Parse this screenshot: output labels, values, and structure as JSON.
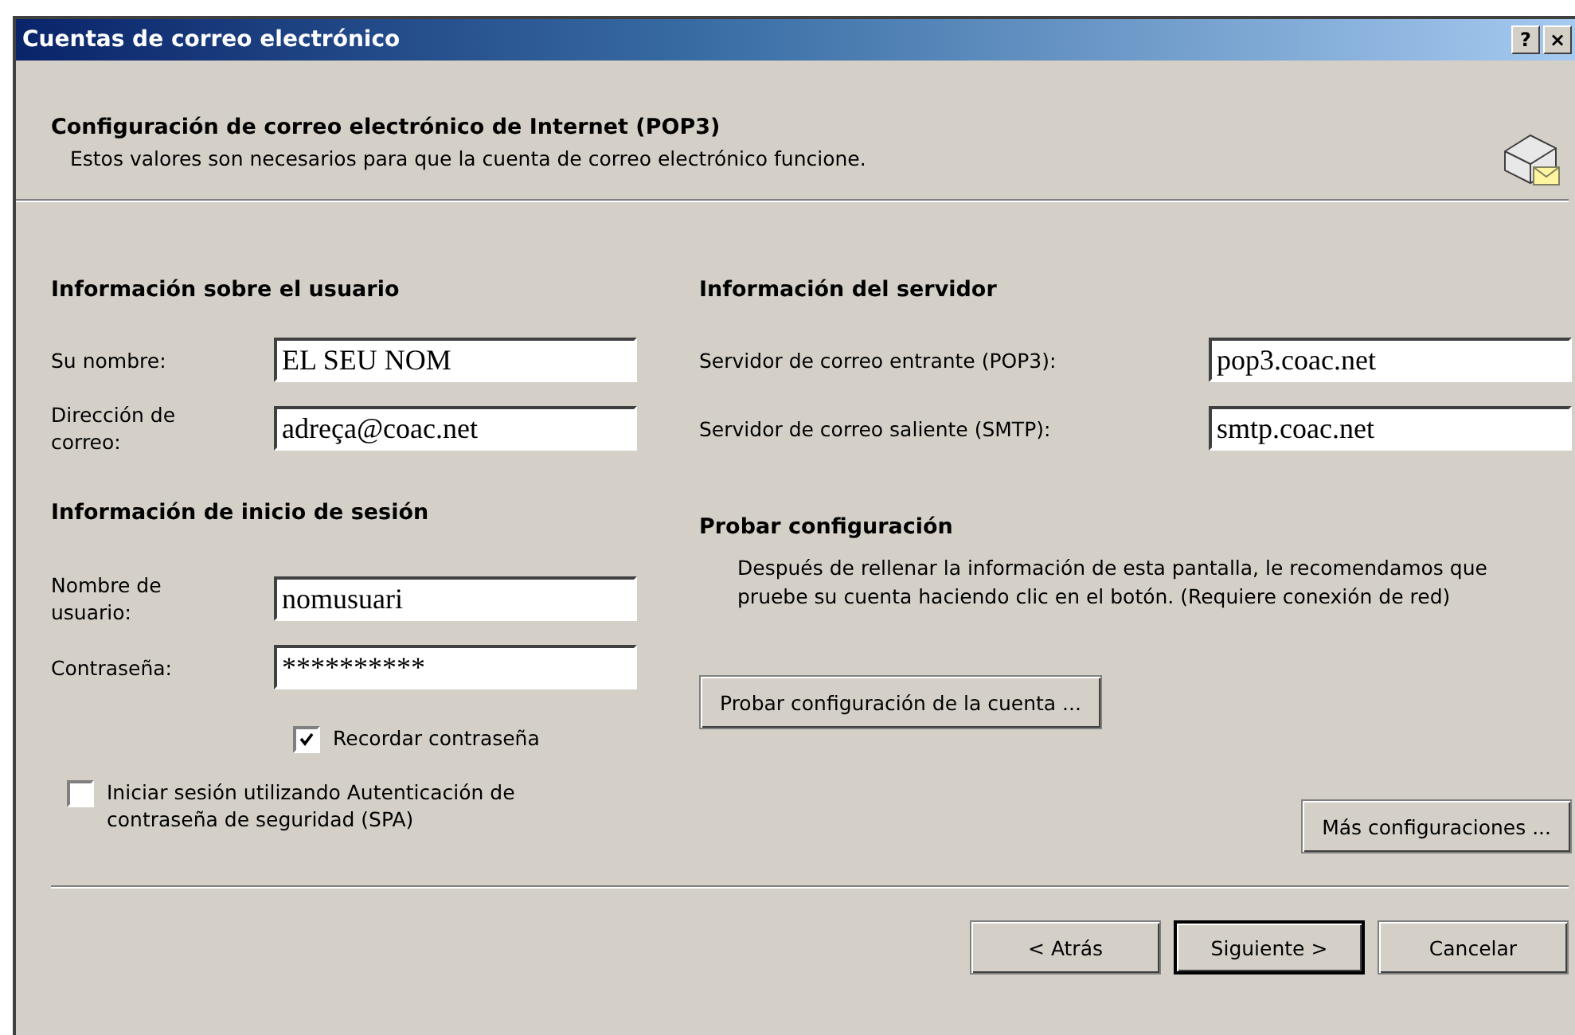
{
  "window": {
    "title": "Cuentas de correo electrónico",
    "title_buttons": [
      "?",
      "×"
    ]
  },
  "header": {
    "title": "Configuración de correo electrónico de Internet (POP3)",
    "subtitle": "Estos valores son necesarios para que la cuenta de correo electrónico funcione."
  },
  "user_info": {
    "heading": "Información sobre el usuario",
    "fields": [
      {
        "label": "Su nombre:",
        "value": "EL SEU NOM"
      },
      {
        "label": "Dirección de correo:",
        "value": "adreça@coac.net"
      }
    ]
  },
  "logon_info": {
    "heading": "Información de inicio de sesión",
    "fields": [
      {
        "label": "Nombre de usuario:",
        "value": "nomusuari"
      },
      {
        "label": "Contraseña:",
        "value": "**********"
      }
    ],
    "remember_password": {
      "label": "Recordar contraseña",
      "checked": true
    },
    "spa": {
      "label": "Iniciar sesión utilizando Autenticación de contraseña de seguridad (SPA)",
      "checked": false
    }
  },
  "server_info": {
    "heading": "Información del servidor",
    "fields": [
      {
        "label": "Servidor de correo entrante (POP3):",
        "value": "pop3.coac.net"
      },
      {
        "label": "Servidor de correo saliente (SMTP):",
        "value": "smtp.coac.net"
      }
    ]
  },
  "test": {
    "heading": "Probar configuración",
    "text": "Después de rellenar la información de esta pantalla, le recomendamos que pruebe su cuenta haciendo clic en el botón. (Requiere conexión de red)",
    "button": "Probar configuración de la cuenta ..."
  },
  "more_button": "Más configuraciones ...",
  "buttons": [
    {
      "label": "< Atrás",
      "default": false
    },
    {
      "label": "Siguiente >",
      "default": true
    },
    {
      "label": "Cancelar",
      "default": false
    }
  ]
}
